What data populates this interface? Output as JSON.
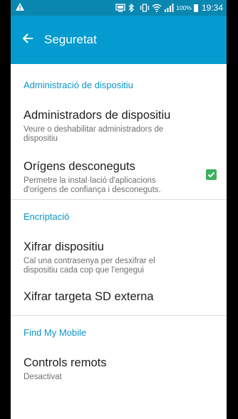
{
  "statusbar": {
    "battery": "100%",
    "time": "19:34"
  },
  "appbar": {
    "title": "Seguretat"
  },
  "sections": [
    {
      "header": "Administració de dispositiu",
      "items": [
        {
          "title": "Administradors de dispositiu",
          "subtitle": "Veure o deshabilitar administradors de dispositiu"
        },
        {
          "title": "Orígens desconeguts",
          "subtitle": "Permetre la instal·lació d'aplicacions d'orígens de confiança i desconeguts.",
          "checked": true
        }
      ]
    },
    {
      "header": "Encriptació",
      "items": [
        {
          "title": "Xifrar dispositiu",
          "subtitle": "Cal una contrasenya per desxifrar el dispositiu cada cop que l'engegui"
        },
        {
          "title": "Xifrar targeta SD externa"
        }
      ]
    },
    {
      "header": "Find My Mobile",
      "items": [
        {
          "title": "Controls remots",
          "subtitle": "Desactivat"
        }
      ]
    }
  ],
  "colors": {
    "statusbar": "#0987b0",
    "appbar": "#039bd0",
    "accent": "#0b95c7",
    "checkbox": "#3cb25e"
  }
}
